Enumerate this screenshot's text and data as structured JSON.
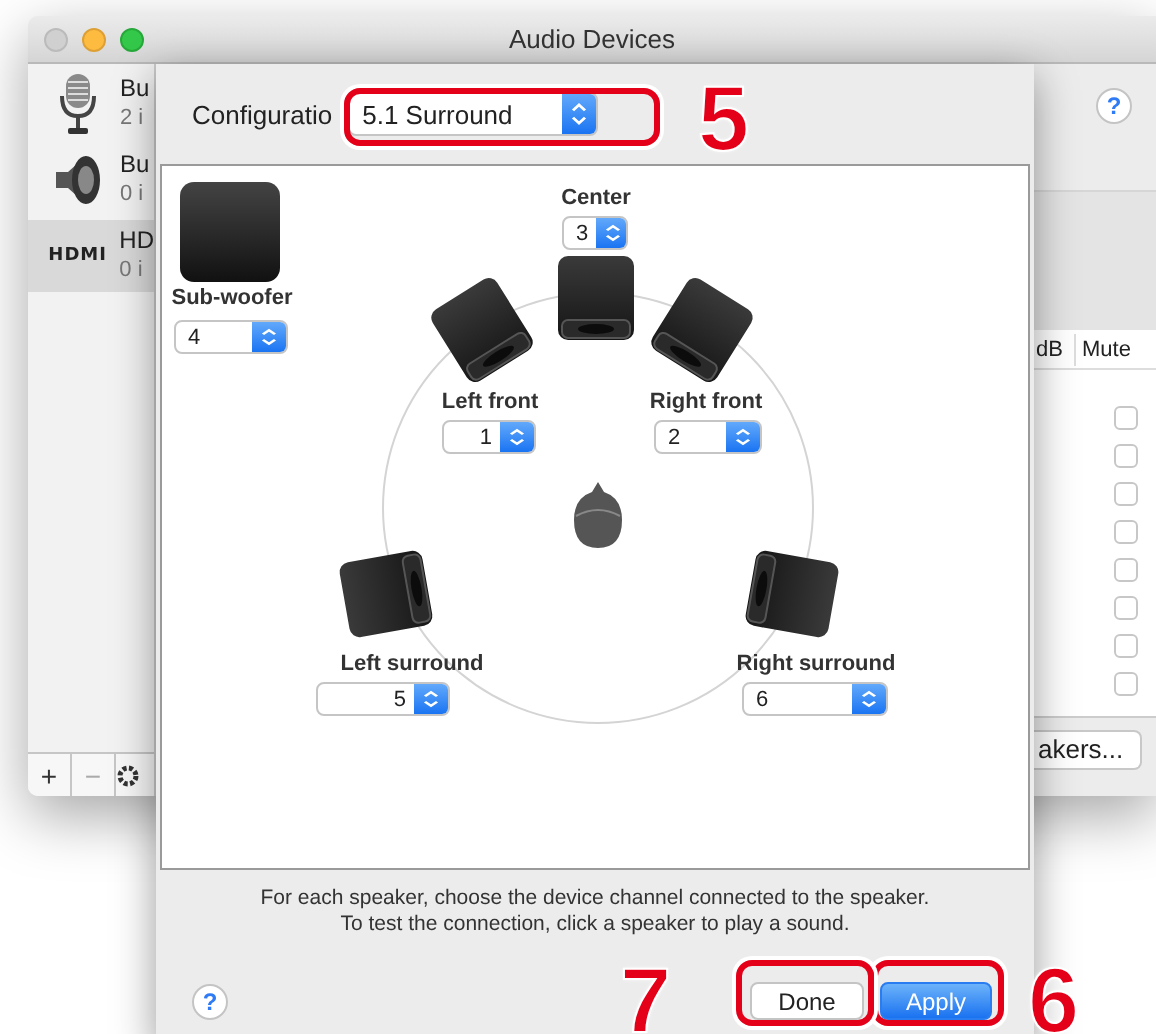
{
  "window": {
    "title": "Audio Devices",
    "help_button": "?"
  },
  "sidebar": {
    "items": [
      {
        "kind": "microphone",
        "name": "Bu",
        "detail": "2 i",
        "selected": false
      },
      {
        "kind": "speaker",
        "name": "Bu",
        "detail": "0 i",
        "selected": false
      },
      {
        "kind": "hdmi",
        "logo": "HDMI",
        "name": "HD",
        "detail": "0 i",
        "selected": true
      }
    ],
    "toolbar": [
      "+",
      "−"
    ]
  },
  "table": {
    "columns": [
      "dB",
      "Mute"
    ],
    "rows": [
      {
        "mute": false
      },
      {
        "mute": false
      },
      {
        "mute": false
      },
      {
        "mute": false
      },
      {
        "mute": false
      },
      {
        "mute": false
      },
      {
        "mute": false
      },
      {
        "mute": false
      }
    ]
  },
  "configure_button": "akers...",
  "sheet": {
    "configuration_label": "Configuratio",
    "configuration": "5.1 Surround",
    "speakers": [
      {
        "kind": "subwoofer",
        "label": "Sub-woofer",
        "channel": "4"
      },
      {
        "kind": "center",
        "label": "Center",
        "channel": "3"
      },
      {
        "kind": "left-front",
        "label": "Left front",
        "channel": "1"
      },
      {
        "kind": "right-front",
        "label": "Right front",
        "channel": "2"
      },
      {
        "kind": "left-surround",
        "label": "Left surround",
        "channel": "5"
      },
      {
        "kind": "right-surround",
        "label": "Right surround",
        "channel": "6"
      }
    ],
    "instructions": [
      "For each speaker, choose the device channel connected to the speaker.",
      "To test the connection, click a speaker to play a sound."
    ],
    "help_button": "?",
    "buttons": [
      {
        "label": "Done",
        "kind": "default"
      },
      {
        "label": "Apply",
        "kind": "primary"
      }
    ]
  },
  "annotations": [
    {
      "label": "5"
    },
    {
      "label": "6"
    },
    {
      "label": "7"
    }
  ]
}
